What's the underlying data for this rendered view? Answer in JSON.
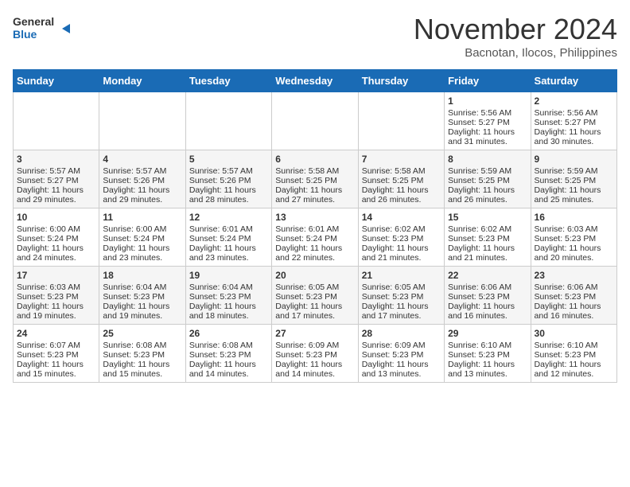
{
  "header": {
    "logo_line1": "General",
    "logo_line2": "Blue",
    "month_title": "November 2024",
    "location": "Bacnotan, Ilocos, Philippines"
  },
  "weekdays": [
    "Sunday",
    "Monday",
    "Tuesday",
    "Wednesday",
    "Thursday",
    "Friday",
    "Saturday"
  ],
  "weeks": [
    [
      {
        "day": "",
        "sunrise": "",
        "sunset": "",
        "daylight": ""
      },
      {
        "day": "",
        "sunrise": "",
        "sunset": "",
        "daylight": ""
      },
      {
        "day": "",
        "sunrise": "",
        "sunset": "",
        "daylight": ""
      },
      {
        "day": "",
        "sunrise": "",
        "sunset": "",
        "daylight": ""
      },
      {
        "day": "",
        "sunrise": "",
        "sunset": "",
        "daylight": ""
      },
      {
        "day": "1",
        "sunrise": "Sunrise: 5:56 AM",
        "sunset": "Sunset: 5:27 PM",
        "daylight": "Daylight: 11 hours and 31 minutes."
      },
      {
        "day": "2",
        "sunrise": "Sunrise: 5:56 AM",
        "sunset": "Sunset: 5:27 PM",
        "daylight": "Daylight: 11 hours and 30 minutes."
      }
    ],
    [
      {
        "day": "3",
        "sunrise": "Sunrise: 5:57 AM",
        "sunset": "Sunset: 5:27 PM",
        "daylight": "Daylight: 11 hours and 29 minutes."
      },
      {
        "day": "4",
        "sunrise": "Sunrise: 5:57 AM",
        "sunset": "Sunset: 5:26 PM",
        "daylight": "Daylight: 11 hours and 29 minutes."
      },
      {
        "day": "5",
        "sunrise": "Sunrise: 5:57 AM",
        "sunset": "Sunset: 5:26 PM",
        "daylight": "Daylight: 11 hours and 28 minutes."
      },
      {
        "day": "6",
        "sunrise": "Sunrise: 5:58 AM",
        "sunset": "Sunset: 5:25 PM",
        "daylight": "Daylight: 11 hours and 27 minutes."
      },
      {
        "day": "7",
        "sunrise": "Sunrise: 5:58 AM",
        "sunset": "Sunset: 5:25 PM",
        "daylight": "Daylight: 11 hours and 26 minutes."
      },
      {
        "day": "8",
        "sunrise": "Sunrise: 5:59 AM",
        "sunset": "Sunset: 5:25 PM",
        "daylight": "Daylight: 11 hours and 26 minutes."
      },
      {
        "day": "9",
        "sunrise": "Sunrise: 5:59 AM",
        "sunset": "Sunset: 5:25 PM",
        "daylight": "Daylight: 11 hours and 25 minutes."
      }
    ],
    [
      {
        "day": "10",
        "sunrise": "Sunrise: 6:00 AM",
        "sunset": "Sunset: 5:24 PM",
        "daylight": "Daylight: 11 hours and 24 minutes."
      },
      {
        "day": "11",
        "sunrise": "Sunrise: 6:00 AM",
        "sunset": "Sunset: 5:24 PM",
        "daylight": "Daylight: 11 hours and 23 minutes."
      },
      {
        "day": "12",
        "sunrise": "Sunrise: 6:01 AM",
        "sunset": "Sunset: 5:24 PM",
        "daylight": "Daylight: 11 hours and 23 minutes."
      },
      {
        "day": "13",
        "sunrise": "Sunrise: 6:01 AM",
        "sunset": "Sunset: 5:24 PM",
        "daylight": "Daylight: 11 hours and 22 minutes."
      },
      {
        "day": "14",
        "sunrise": "Sunrise: 6:02 AM",
        "sunset": "Sunset: 5:23 PM",
        "daylight": "Daylight: 11 hours and 21 minutes."
      },
      {
        "day": "15",
        "sunrise": "Sunrise: 6:02 AM",
        "sunset": "Sunset: 5:23 PM",
        "daylight": "Daylight: 11 hours and 21 minutes."
      },
      {
        "day": "16",
        "sunrise": "Sunrise: 6:03 AM",
        "sunset": "Sunset: 5:23 PM",
        "daylight": "Daylight: 11 hours and 20 minutes."
      }
    ],
    [
      {
        "day": "17",
        "sunrise": "Sunrise: 6:03 AM",
        "sunset": "Sunset: 5:23 PM",
        "daylight": "Daylight: 11 hours and 19 minutes."
      },
      {
        "day": "18",
        "sunrise": "Sunrise: 6:04 AM",
        "sunset": "Sunset: 5:23 PM",
        "daylight": "Daylight: 11 hours and 19 minutes."
      },
      {
        "day": "19",
        "sunrise": "Sunrise: 6:04 AM",
        "sunset": "Sunset: 5:23 PM",
        "daylight": "Daylight: 11 hours and 18 minutes."
      },
      {
        "day": "20",
        "sunrise": "Sunrise: 6:05 AM",
        "sunset": "Sunset: 5:23 PM",
        "daylight": "Daylight: 11 hours and 17 minutes."
      },
      {
        "day": "21",
        "sunrise": "Sunrise: 6:05 AM",
        "sunset": "Sunset: 5:23 PM",
        "daylight": "Daylight: 11 hours and 17 minutes."
      },
      {
        "day": "22",
        "sunrise": "Sunrise: 6:06 AM",
        "sunset": "Sunset: 5:23 PM",
        "daylight": "Daylight: 11 hours and 16 minutes."
      },
      {
        "day": "23",
        "sunrise": "Sunrise: 6:06 AM",
        "sunset": "Sunset: 5:23 PM",
        "daylight": "Daylight: 11 hours and 16 minutes."
      }
    ],
    [
      {
        "day": "24",
        "sunrise": "Sunrise: 6:07 AM",
        "sunset": "Sunset: 5:23 PM",
        "daylight": "Daylight: 11 hours and 15 minutes."
      },
      {
        "day": "25",
        "sunrise": "Sunrise: 6:08 AM",
        "sunset": "Sunset: 5:23 PM",
        "daylight": "Daylight: 11 hours and 15 minutes."
      },
      {
        "day": "26",
        "sunrise": "Sunrise: 6:08 AM",
        "sunset": "Sunset: 5:23 PM",
        "daylight": "Daylight: 11 hours and 14 minutes."
      },
      {
        "day": "27",
        "sunrise": "Sunrise: 6:09 AM",
        "sunset": "Sunset: 5:23 PM",
        "daylight": "Daylight: 11 hours and 14 minutes."
      },
      {
        "day": "28",
        "sunrise": "Sunrise: 6:09 AM",
        "sunset": "Sunset: 5:23 PM",
        "daylight": "Daylight: 11 hours and 13 minutes."
      },
      {
        "day": "29",
        "sunrise": "Sunrise: 6:10 AM",
        "sunset": "Sunset: 5:23 PM",
        "daylight": "Daylight: 11 hours and 13 minutes."
      },
      {
        "day": "30",
        "sunrise": "Sunrise: 6:10 AM",
        "sunset": "Sunset: 5:23 PM",
        "daylight": "Daylight: 11 hours and 12 minutes."
      }
    ]
  ]
}
